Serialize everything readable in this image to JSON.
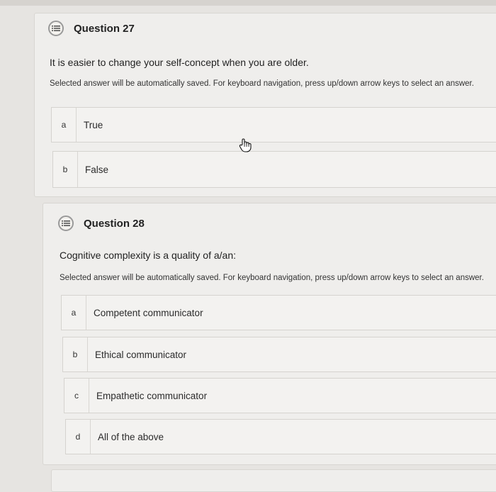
{
  "questions": [
    {
      "title": "Question 27",
      "text": "It is easier to change your self-concept when you are older.",
      "hint": "Selected answer will be automatically saved. For keyboard navigation, press up/down arrow keys to select an answer.",
      "options": [
        {
          "letter": "a",
          "label": "True"
        },
        {
          "letter": "b",
          "label": "False"
        }
      ]
    },
    {
      "title": "Question 28",
      "text": "Cognitive complexity is a quality of a/an:",
      "hint": "Selected answer will be automatically saved. For keyboard navigation, press up/down arrow keys to select an answer.",
      "options": [
        {
          "letter": "a",
          "label": "Competent communicator"
        },
        {
          "letter": "b",
          "label": "Ethical communicator"
        },
        {
          "letter": "c",
          "label": "Empathetic communicator"
        },
        {
          "letter": "d",
          "label": "All of the above"
        }
      ]
    }
  ],
  "icons": {
    "question": "question-list-icon",
    "cursor": "hand-pointer-icon"
  },
  "colors": {
    "background": "#e6e4e1",
    "card": "#efeeec",
    "option": "#f3f2f0"
  }
}
